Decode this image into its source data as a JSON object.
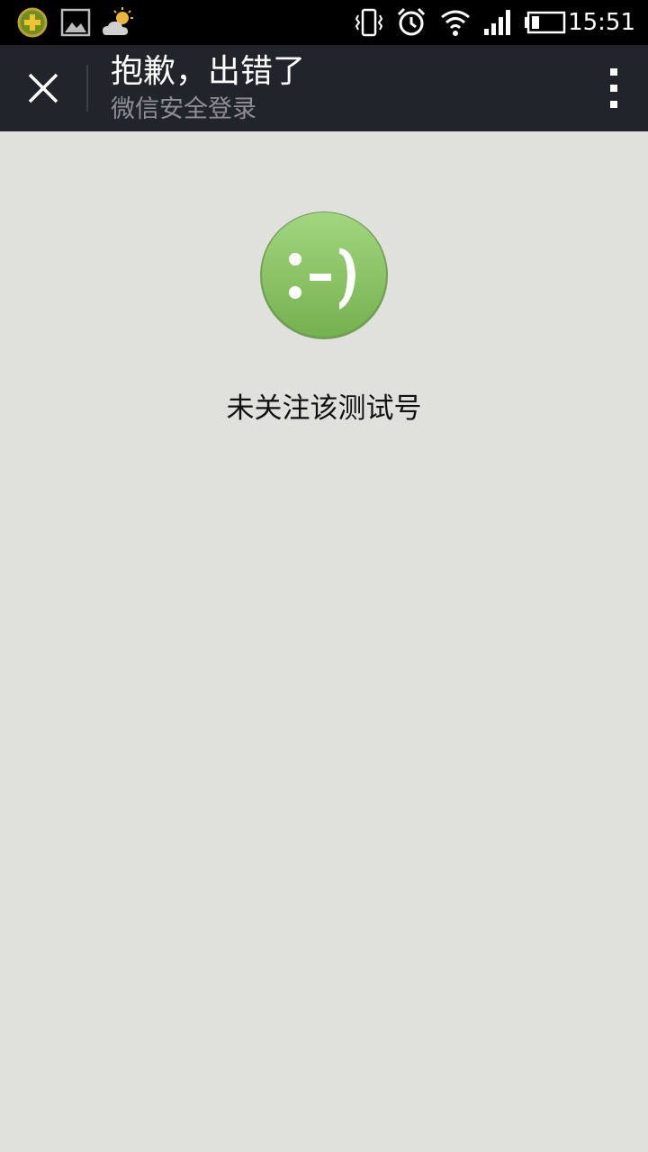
{
  "status_bar": {
    "time": "15:51",
    "left_icons": [
      "app-notification-icon",
      "gallery-icon",
      "weather-icon"
    ],
    "right_icons": [
      "vibrate-icon",
      "alarm-icon",
      "wifi-icon",
      "signal-icon",
      "battery-icon"
    ]
  },
  "action_bar": {
    "title": "抱歉，出错了",
    "subtitle": "微信安全登录",
    "close_icon": "close-icon",
    "menu_icon": "more-vert-icon"
  },
  "content": {
    "emoticon": ":-)",
    "message": "未关注该测试号"
  },
  "colors": {
    "status_bar_bg": "#000000",
    "action_bar_bg": "#21252b",
    "page_bg": "#e0e0dd",
    "accent_green": "#8cc66a",
    "subtitle_gray": "#8e9094"
  }
}
